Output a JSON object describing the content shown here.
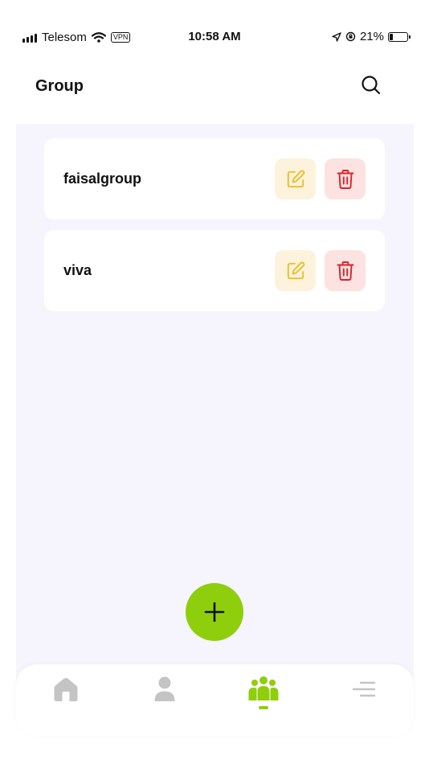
{
  "status_bar": {
    "carrier": "Telesom",
    "vpn_label": "VPN",
    "time": "10:58 AM",
    "battery_percent": "21%",
    "battery_level": 0.21
  },
  "header": {
    "title": "Group",
    "search_icon": "search-icon"
  },
  "groups": [
    {
      "name": "faisalgroup",
      "edit_icon": "edit-icon",
      "delete_icon": "trash-icon"
    },
    {
      "name": "viva",
      "edit_icon": "edit-icon",
      "delete_icon": "trash-icon"
    }
  ],
  "fab": {
    "icon": "plus-icon"
  },
  "bottom_nav": {
    "items": [
      {
        "icon": "home-icon",
        "active": false
      },
      {
        "icon": "user-icon",
        "active": false
      },
      {
        "icon": "group-icon",
        "active": true
      },
      {
        "icon": "menu-icon",
        "active": false
      }
    ]
  },
  "colors": {
    "accent": "#8fce0d",
    "background": "#f6f5fd",
    "edit_bg": "#fdf3dc",
    "edit_icon": "#ecbe2b",
    "delete_bg": "#fde2e2",
    "delete_icon": "#d8232a",
    "nav_inactive": "#c4c4c4"
  }
}
